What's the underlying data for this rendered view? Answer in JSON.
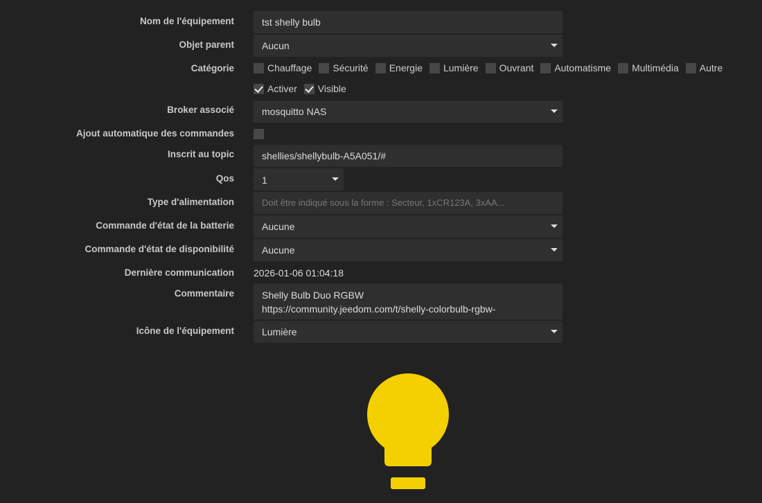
{
  "fields": {
    "name": {
      "label": "Nom de l'équipement",
      "value": "tst shelly bulb"
    },
    "parent": {
      "label": "Objet parent",
      "value": "Aucun"
    },
    "category": {
      "label": "Catégorie",
      "options": [
        "Chauffage",
        "Sécurité",
        "Energie",
        "Lumière",
        "Ouvrant",
        "Automatisme",
        "Multimédia",
        "Autre"
      ]
    },
    "activate": {
      "label": "Activer",
      "checked": true
    },
    "visible": {
      "label": "Visible",
      "checked": true
    },
    "broker": {
      "label": "Broker associé",
      "value": "mosquitto NAS"
    },
    "auto_add": {
      "label": "Ajout automatique des commandes",
      "checked": false
    },
    "topic": {
      "label": "Inscrit au topic",
      "value": "shellies/shellybulb-A5A051/#"
    },
    "qos": {
      "label": "Qos",
      "value": "1"
    },
    "power": {
      "label": "Type d'alimentation",
      "placeholder": "Doit être indiqué sous la forme : Secteur, 1xCR123A, 3xAA..."
    },
    "battery_cmd": {
      "label": "Commande d'état de la batterie",
      "value": "Aucune"
    },
    "availability_cmd": {
      "label": "Commande d'état de disponibilité",
      "value": "Aucune"
    },
    "last_comm": {
      "label": "Dernière communication",
      "value": "2026-01-06 01:04:18"
    },
    "comment": {
      "label": "Commentaire",
      "line1": "Shelly Bulb Duo RGBW",
      "line2": "https://community.jeedom.com/t/shelly-colorbulb-rgbw-"
    },
    "icon": {
      "label": "Icône de l'équipement",
      "value": "Lumière",
      "icon_name": "lightbulb-icon",
      "color": "#f5d000"
    }
  }
}
